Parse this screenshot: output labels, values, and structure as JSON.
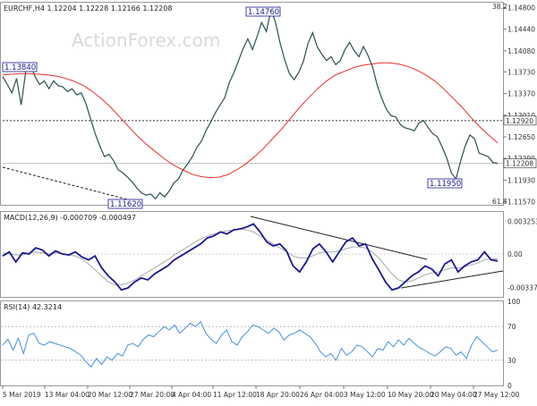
{
  "chart_data": [
    {
      "type": "line",
      "symbol_header": "EURCHF,H4  1.12204 1.12228 1.12166 1.12208",
      "watermark": "ActionForex.com",
      "y_ticks": [
        "1.14800",
        "1.14440",
        "1.14080",
        "1.13730",
        "1.13370",
        "1.13010",
        "1.12650",
        "1.12290",
        "1.11930",
        "1.11570"
      ],
      "ylim": [
        1.1152,
        1.1488
      ],
      "current_price_label": "1.12208",
      "current_price": 1.12208,
      "level_line_label": "1.12920",
      "level_line": 1.1292,
      "fib_top_label": "38.2",
      "fib_bottom_label": "61.8",
      "annotations": [
        {
          "label": "1.13840",
          "price": 1.1384
        },
        {
          "label": "1.14760",
          "price": 1.1476
        },
        {
          "label": "1.11620",
          "price": 1.1162
        },
        {
          "label": "1.11950",
          "price": 1.1195
        }
      ],
      "series": [
        {
          "name": "price",
          "color": "#2f4f4f",
          "values": [
            1.1365,
            1.1352,
            1.1338,
            1.1362,
            1.1318,
            1.1374,
            1.1384,
            1.1365,
            1.1352,
            1.1358,
            1.1345,
            1.1358,
            1.135,
            1.1348,
            1.134,
            1.1345,
            1.1335,
            1.1338,
            1.132,
            1.1295,
            1.127,
            1.125,
            1.1232,
            1.1236,
            1.1225,
            1.121,
            1.1205,
            1.1198,
            1.119,
            1.118,
            1.1172,
            1.1168,
            1.117,
            1.1162,
            1.1172,
            1.1165,
            1.1175,
            1.1188,
            1.1195,
            1.121,
            1.122,
            1.1232,
            1.1248,
            1.1258,
            1.1276,
            1.129,
            1.1305,
            1.1318,
            1.133,
            1.1355,
            1.1372,
            1.1392,
            1.1412,
            1.1428,
            1.141,
            1.1432,
            1.1455,
            1.144,
            1.1476,
            1.1455,
            1.142,
            1.1392,
            1.137,
            1.136,
            1.1372,
            1.139,
            1.142,
            1.1438,
            1.1415,
            1.1402,
            1.1392,
            1.1398,
            1.1385,
            1.1392,
            1.141,
            1.1422,
            1.1408,
            1.1398,
            1.1415,
            1.14,
            1.138,
            1.135,
            1.1328,
            1.131,
            1.13,
            1.1298,
            1.1285,
            1.128,
            1.1278,
            1.1275,
            1.1288,
            1.1292,
            1.128,
            1.127,
            1.1265,
            1.1248,
            1.123,
            1.1205,
            1.1195,
            1.1225,
            1.125,
            1.1268,
            1.1262,
            1.1238,
            1.1235,
            1.1232,
            1.1222,
            1.1221
          ]
        },
        {
          "name": "MA",
          "color": "#e8312b",
          "values": [
            1.1368,
            1.1369,
            1.137,
            1.137,
            1.1369,
            1.1368,
            1.1366,
            1.1362,
            1.1357,
            1.135,
            1.134,
            1.1328,
            1.1314,
            1.1298,
            1.1282,
            1.1266,
            1.1252,
            1.124,
            1.1228,
            1.1218,
            1.121,
            1.1203,
            1.1199,
            1.1197,
            1.1198,
            1.1202,
            1.121,
            1.122,
            1.1232,
            1.1246,
            1.1262,
            1.1278,
            1.1296,
            1.1314,
            1.133,
            1.1345,
            1.1358,
            1.1368,
            1.1374,
            1.138,
            1.1384,
            1.1386,
            1.1388,
            1.1388,
            1.1386,
            1.1382,
            1.1376,
            1.1368,
            1.1358,
            1.1345,
            1.133,
            1.1315,
            1.1298,
            1.1282,
            1.1268,
            1.1255
          ]
        }
      ],
      "x_ticks": [
        "5 Mar 2019",
        "13 Mar 04:00",
        "20 Mar 12:00",
        "27 Mar 20:00",
        "4 Apr 04:00",
        "11 Apr 12:00",
        "18 Apr 20:00",
        "26 Apr 04:00",
        "3 May 12:00",
        "10 May 20:00",
        "20 May 04:00",
        "27 May 12:00"
      ]
    },
    {
      "type": "line",
      "title": "MACD(12,26,9) -0.000709 -0.000497",
      "y_ticks": [
        "0.003253",
        "0.00",
        "-0.003373"
      ],
      "ylim": [
        -0.0043,
        0.0042
      ],
      "series": [
        {
          "name": "MACD",
          "color": "#1a1a8c",
          "values": [
            -0.0002,
            0.0002,
            -0.0008,
            0.0001,
            0.0,
            0.0006,
            0.0004,
            -0.0002,
            0.0003,
            0.0,
            -0.0001,
            0.0002,
            -0.0003,
            -0.0006,
            -0.0002,
            -0.0014,
            -0.0022,
            -0.0028,
            -0.0036,
            -0.0034,
            -0.0028,
            -0.0024,
            -0.0026,
            -0.002,
            -0.0016,
            -0.0012,
            -0.0006,
            -0.0002,
            0.0002,
            0.0006,
            0.001,
            0.0016,
            0.0018,
            0.0022,
            0.002,
            0.0024,
            0.0025,
            0.0027,
            0.003,
            0.0022,
            0.0012,
            0.0008,
            0.001,
            0.0003,
            -0.0012,
            -0.0018,
            -0.0008,
            0.0005,
            0.001,
            0.0002,
            -0.0008,
            0.0002,
            0.0012,
            0.0016,
            0.0008,
            0.001,
            -0.0005,
            -0.0016,
            -0.0028,
            -0.0036,
            -0.0034,
            -0.0028,
            -0.0022,
            -0.0018,
            -0.0012,
            -0.0015,
            -0.0022,
            -0.001,
            -0.0006,
            -0.0018,
            -0.0012,
            -0.0008,
            -0.0006,
            0.0002,
            -0.0006,
            -0.0007
          ]
        },
        {
          "name": "Signal",
          "color": "#aaaaaa",
          "values": [
            0.0001,
            0.0,
            -0.0001,
            -0.0001,
            0.0001,
            0.0002,
            0.0001,
            0.0,
            0.0001,
            0.0,
            -0.0001,
            -0.0002,
            -0.0005,
            -0.001,
            -0.0016,
            -0.0022,
            -0.0028,
            -0.0031,
            -0.0031,
            -0.0029,
            -0.0026,
            -0.0022,
            -0.0018,
            -0.0014,
            -0.001,
            -0.0006,
            -0.0001,
            0.0003,
            0.0007,
            0.0011,
            0.0015,
            0.0018,
            0.002,
            0.0022,
            0.0023,
            0.0024,
            0.0025,
            0.0024,
            0.0022,
            0.0018,
            0.0014,
            0.001,
            0.0006,
            0.0002,
            -0.0002,
            -0.0004,
            -0.0004,
            -0.0002,
            0.0001,
            0.0002,
            0.0002,
            0.0003,
            0.0005,
            0.0007,
            0.0007,
            0.0006,
            0.0002,
            -0.0004,
            -0.0012,
            -0.002,
            -0.0026,
            -0.0028,
            -0.0027,
            -0.0024,
            -0.0021,
            -0.0019,
            -0.0018,
            -0.0016,
            -0.0014,
            -0.0014,
            -0.0013,
            -0.0011,
            -0.0009,
            -0.0006,
            -0.0005,
            -0.0005
          ]
        }
      ]
    },
    {
      "type": "line",
      "title": "RSI(14) 42.3214",
      "y_ticks": [
        "100",
        "70",
        "30",
        "0"
      ],
      "ylim": [
        0,
        100
      ],
      "levels": [
        70,
        30
      ],
      "series": [
        {
          "name": "RSI",
          "color": "#4a90d9",
          "values": [
            48,
            55,
            42,
            56,
            38,
            60,
            62,
            50,
            48,
            52,
            50,
            48,
            46,
            44,
            40,
            36,
            28,
            22,
            32,
            25,
            34,
            30,
            38,
            35,
            48,
            50,
            46,
            55,
            60,
            58,
            64,
            70,
            66,
            72,
            62,
            68,
            74,
            70,
            76,
            62,
            55,
            50,
            60,
            66,
            52,
            48,
            58,
            64,
            72,
            70,
            66,
            62,
            68,
            64,
            54,
            60,
            62,
            66,
            62,
            58,
            50,
            40,
            34,
            38,
            30,
            44,
            36,
            40,
            48,
            46,
            40,
            34,
            44,
            42,
            52,
            46,
            54,
            48,
            56,
            50,
            45,
            42,
            38,
            35,
            40,
            46,
            44,
            36,
            40,
            32,
            48,
            58,
            52,
            46,
            40,
            42
          ]
        }
      ]
    }
  ]
}
